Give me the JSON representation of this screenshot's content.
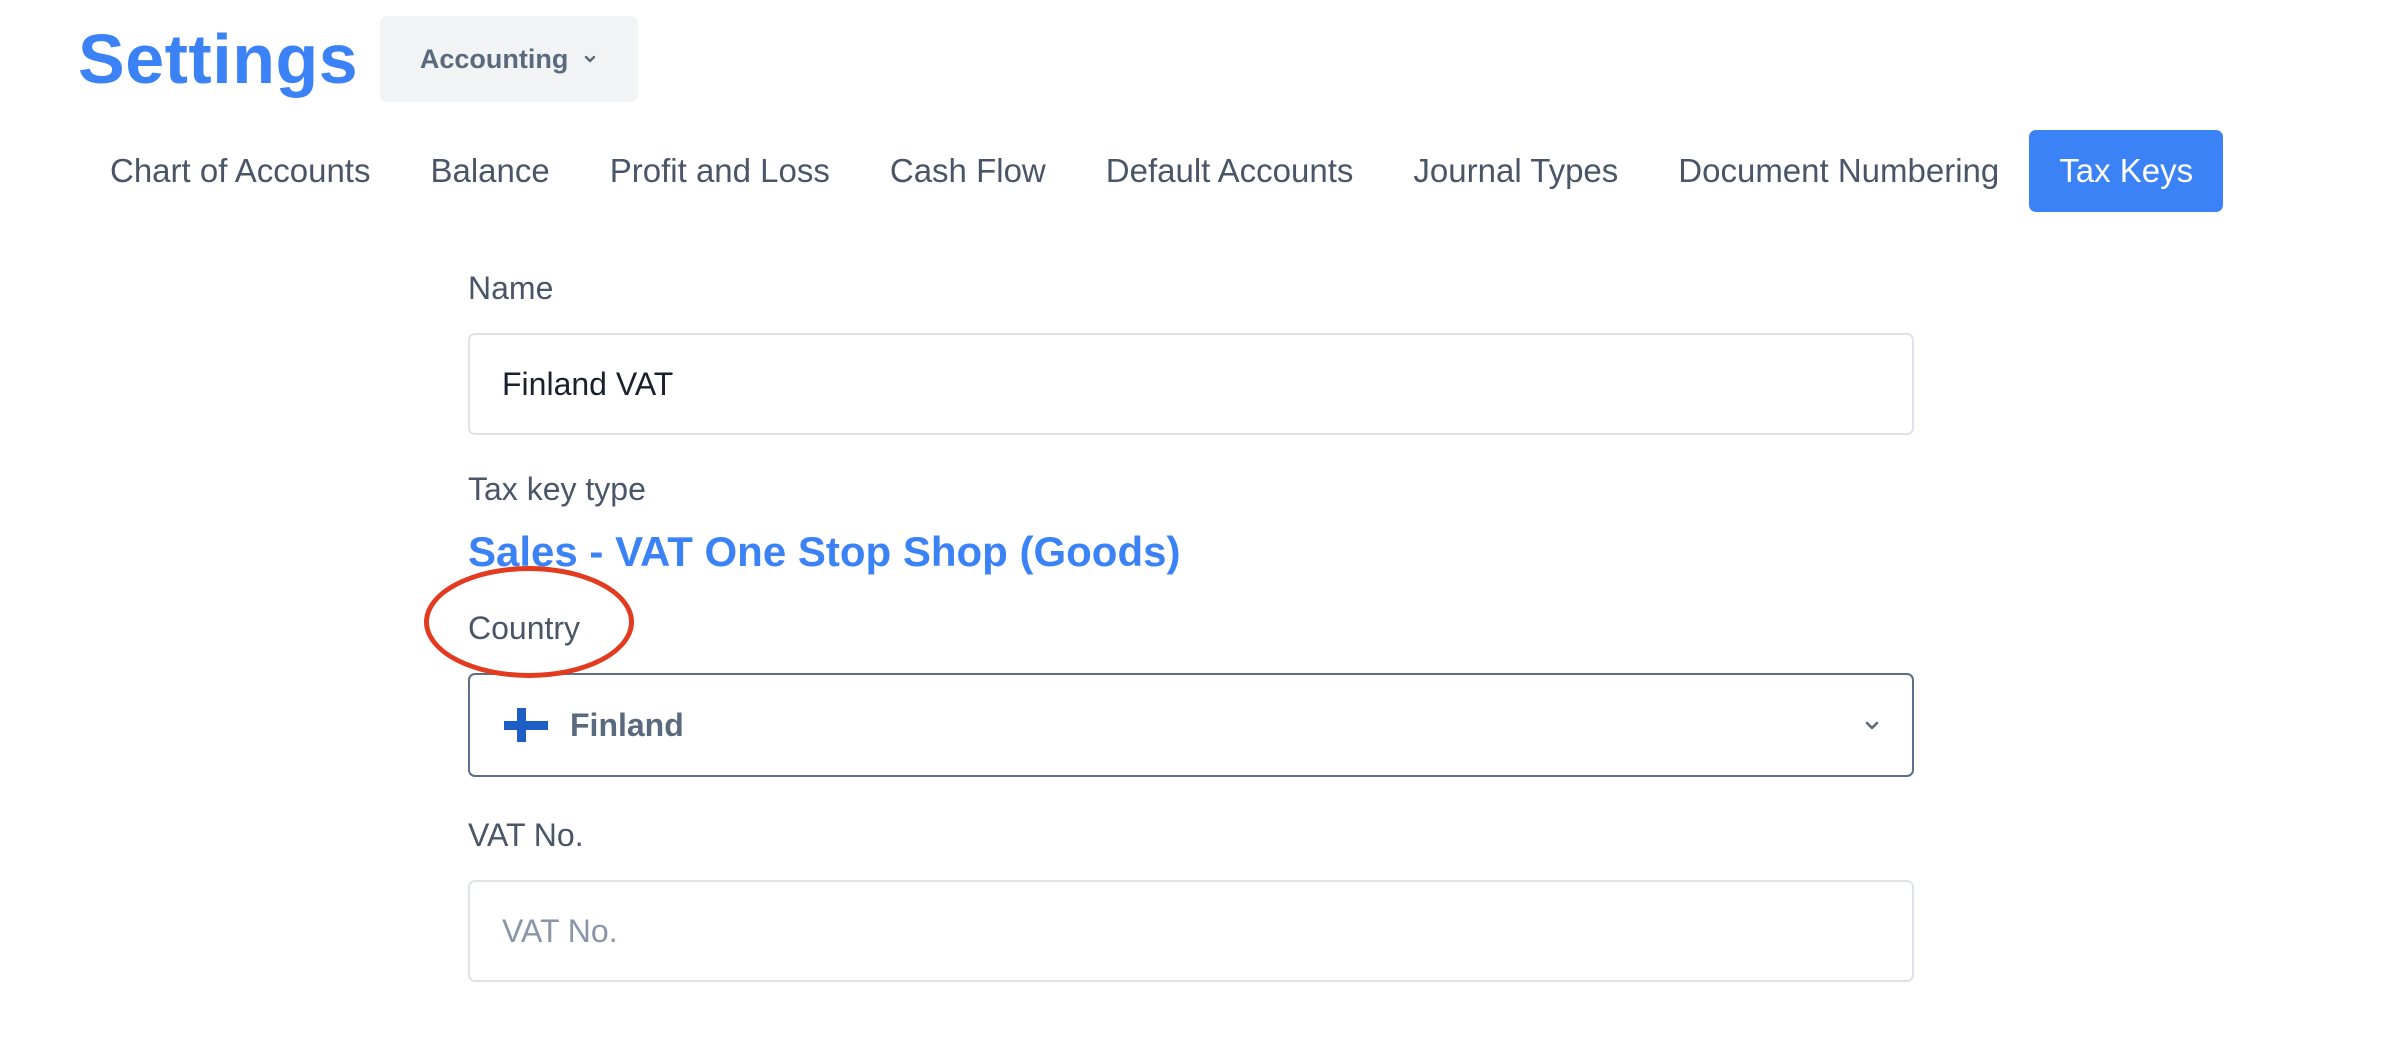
{
  "header": {
    "title": "Settings",
    "section_dropdown": "Accounting"
  },
  "tabs": [
    {
      "label": "Chart of Accounts",
      "active": false
    },
    {
      "label": "Balance",
      "active": false
    },
    {
      "label": "Profit and Loss",
      "active": false
    },
    {
      "label": "Cash Flow",
      "active": false
    },
    {
      "label": "Default Accounts",
      "active": false
    },
    {
      "label": "Journal Types",
      "active": false
    },
    {
      "label": "Document Numbering",
      "active": false
    },
    {
      "label": "Tax Keys",
      "active": true
    }
  ],
  "form": {
    "name": {
      "label": "Name",
      "value": "Finland VAT"
    },
    "tax_key_type": {
      "label": "Tax key type",
      "value": "Sales - VAT One Stop Shop (Goods)"
    },
    "country": {
      "label": "Country",
      "value": "Finland",
      "flag_icon": "finland-flag-icon"
    },
    "vat_no": {
      "label": "VAT No.",
      "value": "",
      "placeholder": "VAT No."
    }
  },
  "colors": {
    "accent": "#3b82f6",
    "annotation": "#e23b1f",
    "text": "#4a5568"
  }
}
